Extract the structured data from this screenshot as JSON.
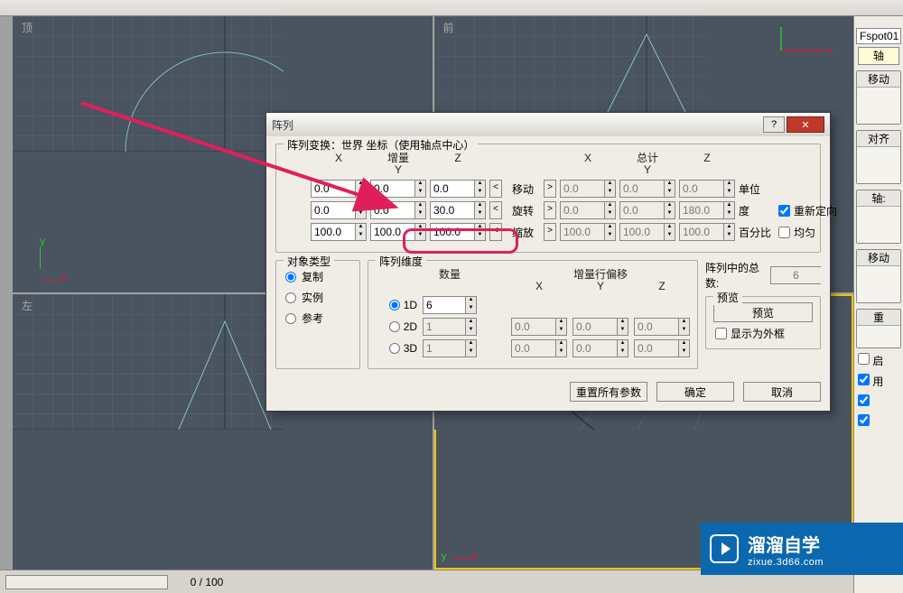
{
  "viewports": {
    "top_label": "顶",
    "front_label": "前",
    "left_label": "左"
  },
  "status": {
    "frame": "0 / 100"
  },
  "cmd": {
    "name": "Fspot01",
    "axis_btn": "轴",
    "rollouts": [
      "移动",
      "对齐",
      "轴:"
    ],
    "sec_move": "移动",
    "sec_weight": "重",
    "chk_qi": "启",
    "chk_yong": "用"
  },
  "dialog": {
    "title": "阵列",
    "transform_legend": "阵列变换：世界 坐标（使用轴点中心）",
    "incremental": "增量",
    "totals": "总计",
    "axes": {
      "x": "X",
      "y": "Y",
      "z": "Z"
    },
    "row_labels": {
      "move": "移动",
      "rotate": "旋转",
      "scale": "缩放"
    },
    "units": {
      "move": "单位",
      "rotate": "度",
      "scale": "百分比"
    },
    "reorient_label": "重新定向",
    "uniform_label": "均匀",
    "move_inc": {
      "x": "0.0",
      "y": "0.0",
      "z": "0.0"
    },
    "move_tot": {
      "x": "0.0",
      "y": "0.0",
      "z": "0.0"
    },
    "rotate_inc": {
      "x": "0.0",
      "y": "0.0",
      "z": "30.0"
    },
    "rotate_tot": {
      "x": "0.0",
      "y": "0.0",
      "z": "180.0"
    },
    "scale_inc": {
      "x": "100.0",
      "y": "100.0",
      "z": "100.0"
    },
    "scale_tot": {
      "x": "100.0",
      "y": "100.0",
      "z": "100.0"
    },
    "objtype_legend": "对象类型",
    "objtype_opts": {
      "copy": "复制",
      "instance": "实例",
      "reference": "参考"
    },
    "dims_legend": "阵列维度",
    "count_label": "数量",
    "offset_label": "增量行偏移",
    "dim": {
      "d1": {
        "label": "1D",
        "count": "6"
      },
      "d2": {
        "label": "2D",
        "count": "1",
        "x": "0.0",
        "y": "0.0",
        "z": "0.0"
      },
      "d3": {
        "label": "3D",
        "count": "1",
        "x": "0.0",
        "y": "0.0",
        "z": "0.0"
      }
    },
    "total_label": "阵列中的总数:",
    "total_value": "6",
    "preview_legend": "预览",
    "preview_btn": "预览",
    "wireframe_label": "显示为外框",
    "reset_btn": "重置所有参数",
    "ok_btn": "确定",
    "cancel_btn": "取消"
  },
  "watermark": {
    "big": "溜溜自学",
    "small": "zixue.3d66.com"
  }
}
